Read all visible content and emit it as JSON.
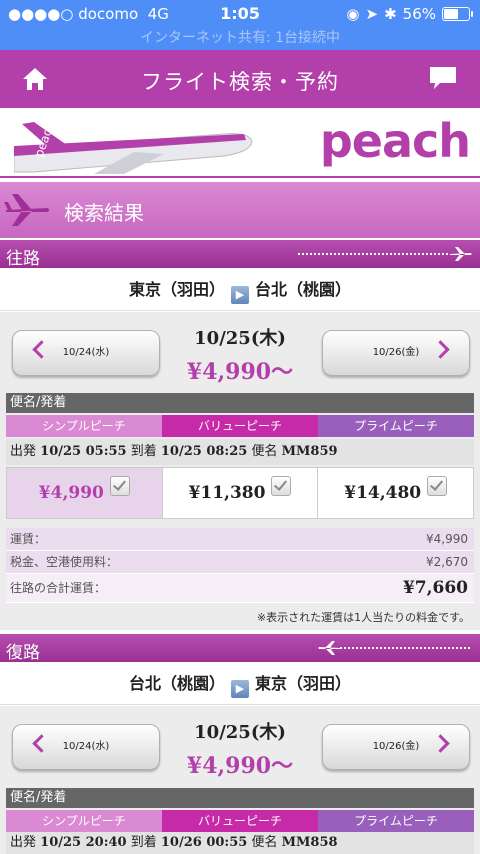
{
  "status": {
    "carrier": "docomo",
    "network": "4G",
    "time": "1:05",
    "battery": "56%"
  },
  "hotspot": "インターネット共有: 1台接続中",
  "header": {
    "title": "フライト検索・予約"
  },
  "brand": "peach",
  "results_title": "検索結果",
  "outbound": {
    "label": "往路",
    "origin": "東京（羽田）",
    "destination": "台北（桃園）",
    "prev_date": "10/24(水)",
    "next_date": "10/26(金)",
    "current_date": "10/25(木)",
    "lowest_price": "¥4,990〜",
    "table_header": "便名/発着",
    "fare_types": [
      "シンプルピーチ",
      "バリューピーチ",
      "プライムピーチ"
    ],
    "flight": {
      "dep_label": "出発",
      "dep": "10/25 05:55",
      "arr_label": "到着",
      "arr": "10/25 08:25",
      "num_label": "便名",
      "num": "MM859"
    },
    "prices": [
      "¥4,990",
      "¥11,380",
      "¥14,480"
    ],
    "breakdown": {
      "fare_label": "運賃：",
      "fare": "¥4,990",
      "tax_label": "税金、空港使用料：",
      "tax": "¥2,670",
      "total_label": "往路の合計運賃：",
      "total": "¥7,660"
    },
    "note": "※表示された運賃は1人当たりの料金です。"
  },
  "return": {
    "label": "復路",
    "origin": "台北（桃園）",
    "destination": "東京（羽田）",
    "prev_date": "10/24(水)",
    "next_date": "10/26(金)",
    "current_date": "10/25(木)",
    "lowest_price": "¥4,990〜",
    "table_header": "便名/発着",
    "fare_types": [
      "シンプルピーチ",
      "バリューピーチ",
      "プライムピーチ"
    ],
    "flight": {
      "dep_label": "出発",
      "dep": "10/25 20:40",
      "arr_label": "到着",
      "arr": "10/26 00:55",
      "num_label": "便名",
      "num": "MM858"
    }
  },
  "colors": {
    "brand": "#b33fab",
    "status_bar": "#4f8ef7"
  }
}
